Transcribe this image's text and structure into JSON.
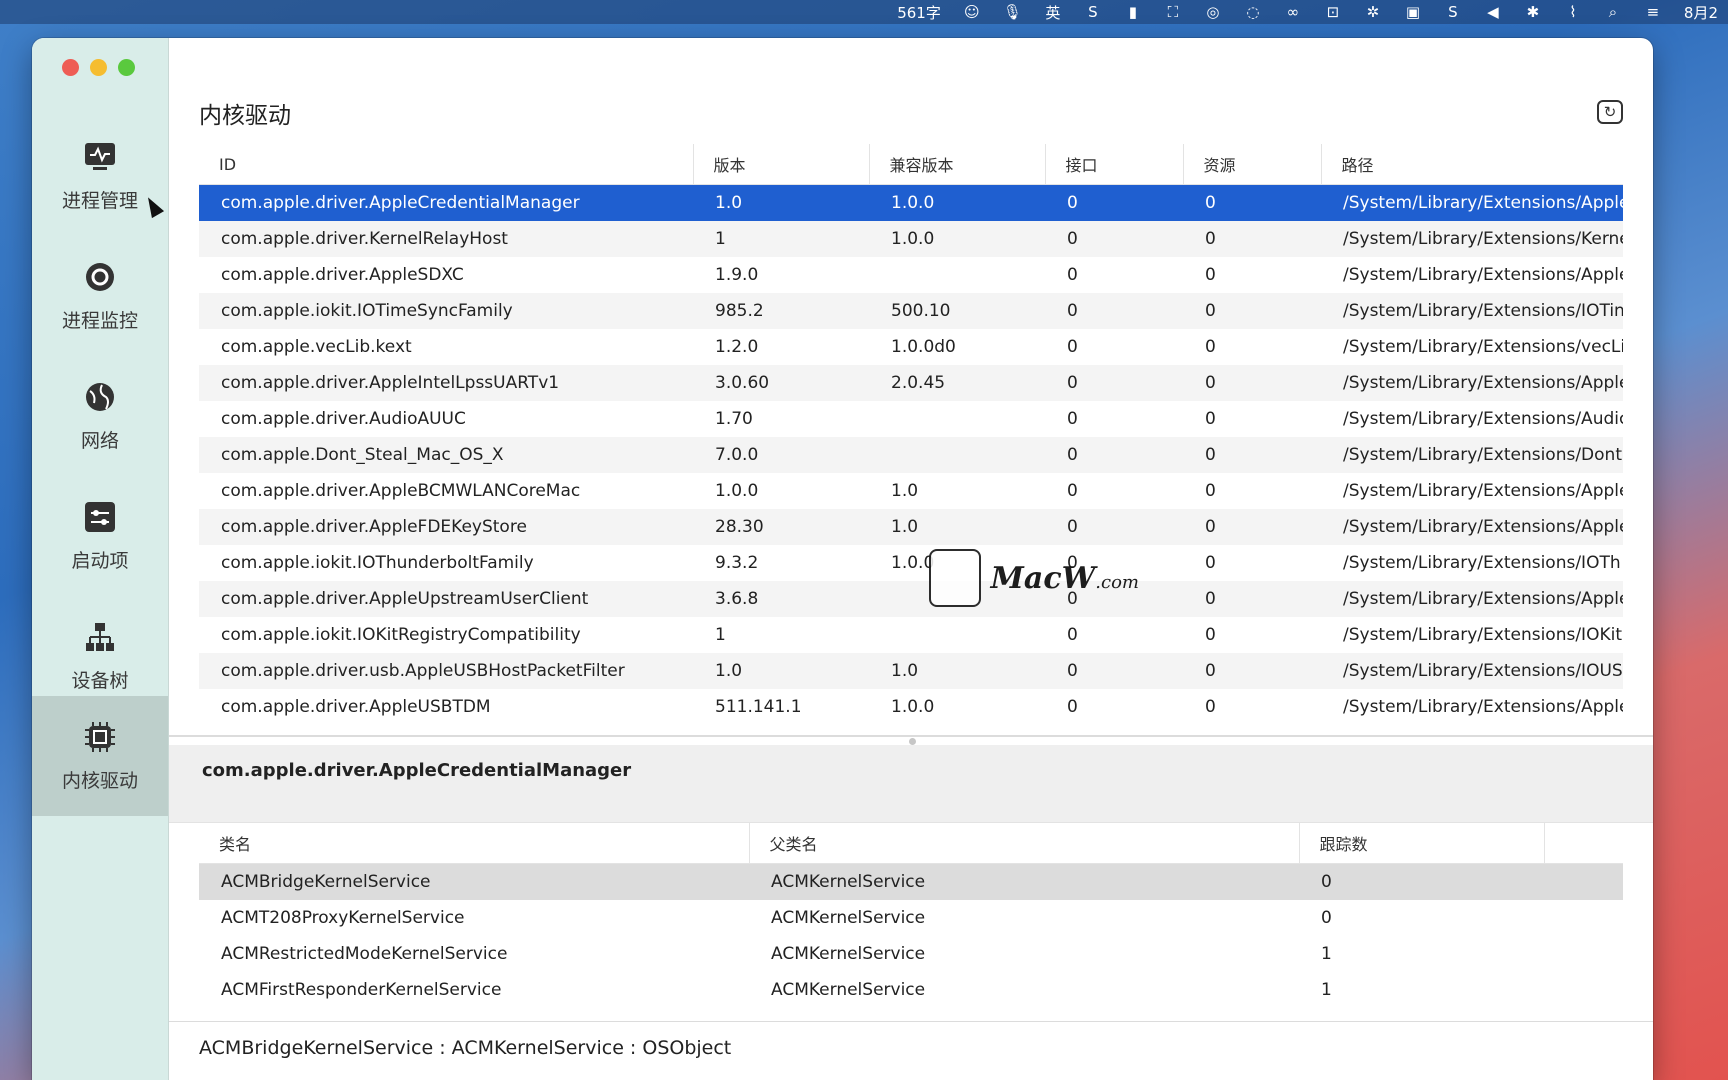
{
  "menubar": {
    "word_count": "561字",
    "input_method": "英",
    "date_fragment": "8月2",
    "icons": [
      "emoji-icon",
      "microphone-icon",
      "input-method-label",
      "s-app-icon",
      "bookmark-icon",
      "screenshot-icon",
      "wechat-icon",
      "chat-bubble-icon",
      "creative-cloud-icon",
      "train-icon",
      "gear-bug-icon",
      "video-icon",
      "sogou-icon",
      "volume-icon",
      "bluetooth-icon",
      "wifi-off-icon",
      "search-icon",
      "control-center-icon"
    ]
  },
  "sidebar": {
    "items": [
      {
        "label": "进程管理",
        "icon": "activity-monitor-icon"
      },
      {
        "label": "进程监控",
        "icon": "monitor-eye-icon"
      },
      {
        "label": "网络",
        "icon": "globe-icon"
      },
      {
        "label": "启动项",
        "icon": "sliders-icon"
      },
      {
        "label": "设备树",
        "icon": "tree-icon"
      },
      {
        "label": "内核驱动",
        "icon": "chip-icon"
      }
    ],
    "active_index": 5
  },
  "main": {
    "title": "内核驱动",
    "columns": [
      "ID",
      "版本",
      "兼容版本",
      "接口",
      "资源",
      "路径"
    ],
    "rows": [
      [
        "com.apple.driver.AppleCredentialManager",
        "1.0",
        "1.0.0",
        "0",
        "0",
        "/System/Library/Extensions/Apple"
      ],
      [
        "com.apple.driver.KernelRelayHost",
        "1",
        "1.0.0",
        "0",
        "0",
        "/System/Library/Extensions/Kerne"
      ],
      [
        "com.apple.driver.AppleSDXC",
        "1.9.0",
        "",
        "0",
        "0",
        "/System/Library/Extensions/Apple"
      ],
      [
        "com.apple.iokit.IOTimeSyncFamily",
        "985.2",
        "500.10",
        "0",
        "0",
        "/System/Library/Extensions/IOTin"
      ],
      [
        "com.apple.vecLib.kext",
        "1.2.0",
        "1.0.0d0",
        "0",
        "0",
        "/System/Library/Extensions/vecLi"
      ],
      [
        "com.apple.driver.AppleIntelLpssUARTv1",
        "3.0.60",
        "2.0.45",
        "0",
        "0",
        "/System/Library/Extensions/Apple"
      ],
      [
        "com.apple.driver.AudioAUUC",
        "1.70",
        "",
        "0",
        "0",
        "/System/Library/Extensions/Audic"
      ],
      [
        "com.apple.Dont_Steal_Mac_OS_X",
        "7.0.0",
        "",
        "0",
        "0",
        "/System/Library/Extensions/Dont"
      ],
      [
        "com.apple.driver.AppleBCMWLANCoreMac",
        "1.0.0",
        "1.0",
        "0",
        "0",
        "/System/Library/Extensions/Apple"
      ],
      [
        "com.apple.driver.AppleFDEKeyStore",
        "28.30",
        "1.0",
        "0",
        "0",
        "/System/Library/Extensions/Apple"
      ],
      [
        "com.apple.iokit.IOThunderboltFamily",
        "9.3.2",
        "1.0.0",
        "0",
        "0",
        "/System/Library/Extensions/IOTh"
      ],
      [
        "com.apple.driver.AppleUpstreamUserClient",
        "3.6.8",
        "",
        "0",
        "0",
        "/System/Library/Extensions/Apple"
      ],
      [
        "com.apple.iokit.IOKitRegistryCompatibility",
        "1",
        "",
        "0",
        "0",
        "/System/Library/Extensions/IOKit"
      ],
      [
        "com.apple.driver.usb.AppleUSBHostPacketFilter",
        "1.0",
        "1.0",
        "0",
        "0",
        "/System/Library/Extensions/IOUS"
      ],
      [
        "com.apple.driver.AppleUSBTDM",
        "511.141.1",
        "1.0.0",
        "0",
        "0",
        "/System/Library/Extensions/Apple"
      ]
    ],
    "selected_index": 0
  },
  "detail": {
    "title": "com.apple.driver.AppleCredentialManager",
    "columns": [
      "类名",
      "父类名",
      "跟踪数"
    ],
    "rows": [
      [
        "ACMBridgeKernelService",
        "ACMKernelService",
        "0"
      ],
      [
        "ACMT208ProxyKernelService",
        "ACMKernelService",
        "0"
      ],
      [
        "ACMRestrictedModeKernelService",
        "ACMKernelService",
        "1"
      ],
      [
        "ACMFirstResponderKernelService",
        "ACMKernelService",
        "1"
      ]
    ],
    "selected_index": 0
  },
  "status": {
    "text": "ACMBridgeKernelService : ACMKernelService : OSObject"
  },
  "watermark": {
    "text": "MacW",
    "suffix": ".com"
  },
  "colors": {
    "selection": "#1f5fd0",
    "sidebar_bg": "#d9ede9",
    "sidebar_active": "#bdcfcb"
  }
}
